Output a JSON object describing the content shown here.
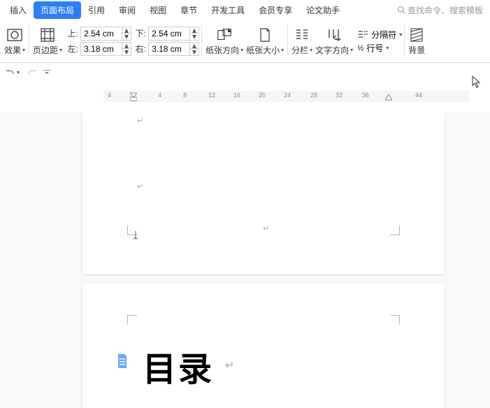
{
  "menu": {
    "items": [
      "插入",
      "页面布局",
      "引用",
      "审阅",
      "视图",
      "章节",
      "开发工具",
      "会员专享",
      "论文助手"
    ],
    "active_index": 1,
    "search_placeholder": "查找命令、搜索模板"
  },
  "ribbon": {
    "effect_label": "效果",
    "margin_label": "页边距",
    "margins": {
      "top_label": "上:",
      "top_value": "2.54 cm",
      "bottom_label": "下:",
      "bottom_value": "2.54 cm",
      "left_label": "左:",
      "left_value": "3.18 cm",
      "right_label": "右:",
      "right_value": "3.18 cm"
    },
    "paper_orient_label": "纸张方向",
    "paper_size_label": "纸张大小",
    "columns_label": "分栏",
    "text_dir_label": "文字方向",
    "line_num_prefix": "½",
    "break_label": "分隔符",
    "line_num_label": "行号",
    "bg_label": "背景"
  },
  "ruler": {
    "marks": [
      4,
      4,
      8,
      12,
      16,
      20,
      24,
      28,
      32,
      36,
      44
    ]
  },
  "document": {
    "heading": "目录"
  }
}
